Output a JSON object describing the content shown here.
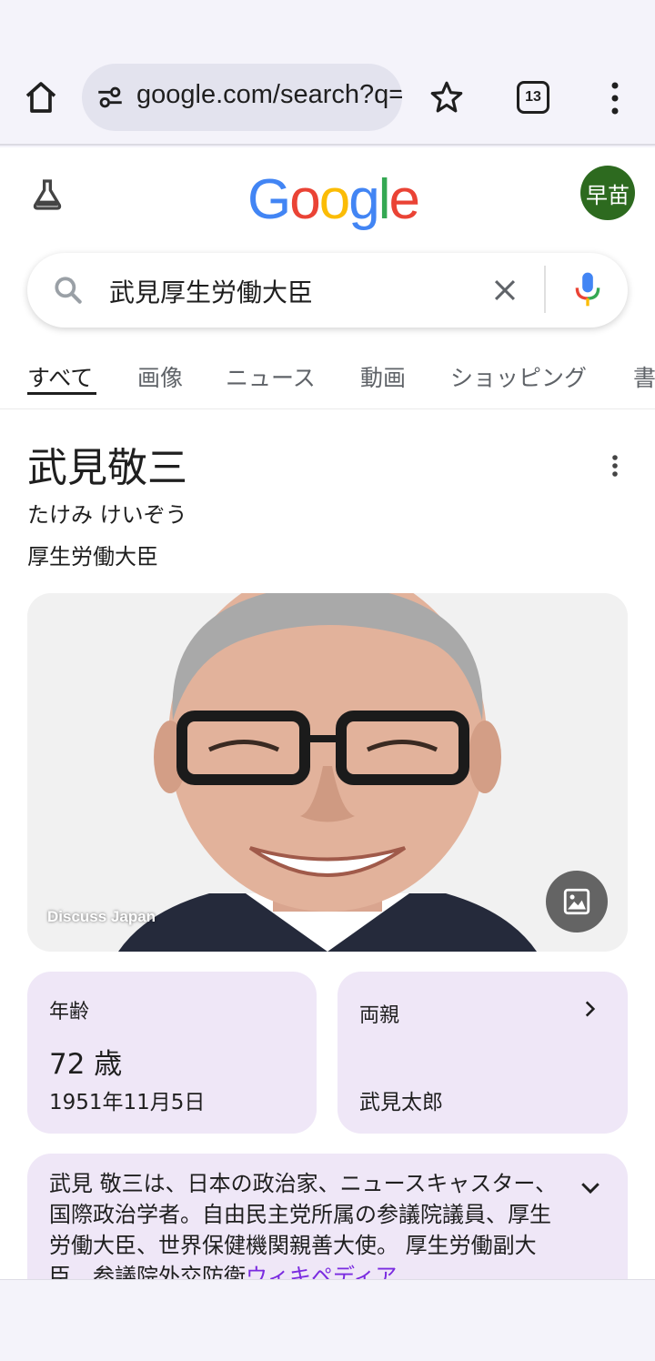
{
  "browser": {
    "url": "google.com/search?q=",
    "tab_count": "13",
    "icons": [
      "home-icon",
      "site-settings-icon",
      "star-icon",
      "tabs-icon",
      "more-vert-icon"
    ]
  },
  "header": {
    "logo": [
      "G",
      "o",
      "o",
      "g",
      "l",
      "e"
    ],
    "logo_colors": [
      "#4285F4",
      "#EA4335",
      "#FBBC05",
      "#4285F4",
      "#34A853",
      "#EA4335"
    ],
    "avatar_text": "早苗",
    "avatar_color": "#2d6a1f"
  },
  "search": {
    "query": "武見厚生労働大臣"
  },
  "tabs": [
    "すべて",
    "画像",
    "ニュース",
    "動画",
    "ショッピング",
    "書"
  ],
  "knowledge_panel": {
    "name": "武見敬三",
    "reading": "たけみ けいぞう",
    "role": "厚生労働大臣",
    "photo_credit": "Discuss Japan",
    "age_card": {
      "label": "年齢",
      "value": "72 歳",
      "birthdate": "1951年11月5日"
    },
    "parent_card": {
      "label": "両親",
      "value": "武見太郎"
    },
    "description": "武見 敬三は、日本の政治家、ニュースキャスター、国際政治学者。自由民主党所属の参議院議員、厚生労働大臣、世界保健機関親善大使。 厚生労働副大臣、参議院外交防衛",
    "description_link": "ウィキペディア"
  },
  "colors": {
    "card_bg": "#efe7f7",
    "link": "#7a2be0",
    "chrome_bg": "#f4f3fa"
  }
}
